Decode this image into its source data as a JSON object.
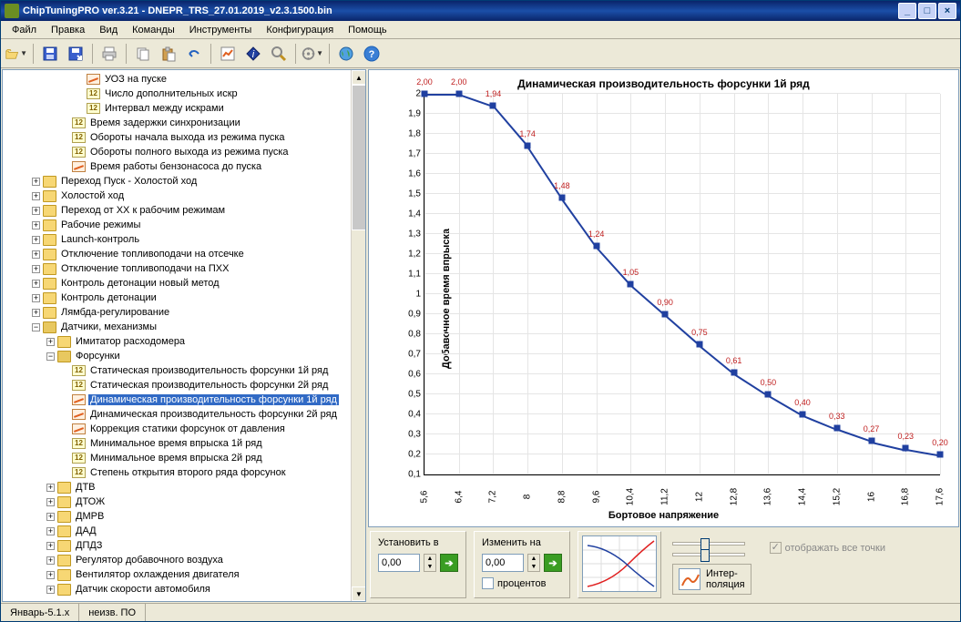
{
  "title": "ChipTuningPRO ver.3.21 - DNEPR_TRS_27.01.2019_v2.3.1500.bin",
  "menu": [
    "Файл",
    "Правка",
    "Вид",
    "Команды",
    "Инструменты",
    "Конфигурация",
    "Помощь"
  ],
  "tree": [
    {
      "d": 5,
      "type": "chart",
      "label": "УОЗ на пуске"
    },
    {
      "d": 5,
      "type": "12",
      "label": "Число дополнительных искр"
    },
    {
      "d": 5,
      "type": "12",
      "label": "Интервал между искрами"
    },
    {
      "d": 4,
      "type": "12",
      "label": "Время задержки синхронизации"
    },
    {
      "d": 4,
      "type": "12",
      "label": "Обороты начала выхода из режима пуска"
    },
    {
      "d": 4,
      "type": "12",
      "label": "Обороты полного выхода из режима пуска"
    },
    {
      "d": 4,
      "type": "chart",
      "label": "Время работы бензонасоса до пуска"
    },
    {
      "d": 2,
      "type": "folder",
      "exp": "+",
      "label": "Переход Пуск - Холостой ход"
    },
    {
      "d": 2,
      "type": "folder",
      "exp": "+",
      "label": "Холостой ход"
    },
    {
      "d": 2,
      "type": "folder",
      "exp": "+",
      "label": "Переход от ХХ к рабочим режимам"
    },
    {
      "d": 2,
      "type": "folder",
      "exp": "+",
      "label": "Рабочие режимы"
    },
    {
      "d": 2,
      "type": "folder",
      "exp": "+",
      "label": "Launch-контроль"
    },
    {
      "d": 2,
      "type": "folder",
      "exp": "+",
      "label": "Отключение топливоподачи на отсечке"
    },
    {
      "d": 2,
      "type": "folder",
      "exp": "+",
      "label": "Отключение топливоподачи на ПХХ"
    },
    {
      "d": 2,
      "type": "folder",
      "exp": "+",
      "label": "Контроль детонации новый метод"
    },
    {
      "d": 2,
      "type": "folder",
      "exp": "+",
      "label": "Контроль детонации"
    },
    {
      "d": 2,
      "type": "folder",
      "exp": "+",
      "label": "Лямбда-регулирование"
    },
    {
      "d": 2,
      "type": "folder-open",
      "exp": "−",
      "label": "Датчики, механизмы"
    },
    {
      "d": 3,
      "type": "folder",
      "exp": "+",
      "label": "Имитатор расходомера"
    },
    {
      "d": 3,
      "type": "folder-open",
      "exp": "−",
      "label": "Форсунки"
    },
    {
      "d": 4,
      "type": "12",
      "label": "Статическая производительность форсунки 1й ряд"
    },
    {
      "d": 4,
      "type": "12",
      "label": "Статическая производительность форсунки 2й ряд"
    },
    {
      "d": 4,
      "type": "chart",
      "label": "Динамическая производительность форсунки 1й ряд",
      "selected": true
    },
    {
      "d": 4,
      "type": "chart",
      "label": "Динамическая производительность форсунки 2й ряд"
    },
    {
      "d": 4,
      "type": "chart",
      "label": "Коррекция статики форсунок от давления"
    },
    {
      "d": 4,
      "type": "12",
      "label": "Минимальное время впрыска 1й ряд"
    },
    {
      "d": 4,
      "type": "12",
      "label": "Минимальное время впрыска 2й ряд"
    },
    {
      "d": 4,
      "type": "12",
      "label": "Степень открытия второго ряда форсунок"
    },
    {
      "d": 3,
      "type": "folder",
      "exp": "+",
      "label": "ДТВ"
    },
    {
      "d": 3,
      "type": "folder",
      "exp": "+",
      "label": "ДТОЖ"
    },
    {
      "d": 3,
      "type": "folder",
      "exp": "+",
      "label": "ДМРВ"
    },
    {
      "d": 3,
      "type": "folder",
      "exp": "+",
      "label": "ДАД"
    },
    {
      "d": 3,
      "type": "folder",
      "exp": "+",
      "label": "ДПДЗ"
    },
    {
      "d": 3,
      "type": "folder",
      "exp": "+",
      "label": "Регулятор добавочного воздуха"
    },
    {
      "d": 3,
      "type": "folder",
      "exp": "+",
      "label": "Вентилятор охлаждения двигателя"
    },
    {
      "d": 3,
      "type": "folder",
      "exp": "+",
      "label": "Датчик скорости автомобиля"
    }
  ],
  "chart_data": {
    "type": "line",
    "title": "Динамическая производительность форсунки 1й ряд",
    "xlabel": "Бортовое напряжение",
    "ylabel": "Добавочное время впрыска",
    "x": [
      5.6,
      6.4,
      7.2,
      8,
      8.8,
      9.6,
      10.4,
      11.2,
      12,
      12.8,
      13.6,
      14.4,
      15.2,
      16,
      16.8,
      17.6
    ],
    "values": [
      2.0,
      2.0,
      1.94,
      1.74,
      1.48,
      1.24,
      1.05,
      0.9,
      0.75,
      0.61,
      0.5,
      0.4,
      0.33,
      0.27,
      0.23,
      0.2
    ],
    "labels": [
      "2,00",
      "2,00",
      "1,94",
      "1,74",
      "1,48",
      "1,24",
      "1,05",
      "0,90",
      "0,75",
      "0,61",
      "0,50",
      "0,40",
      "0,33",
      "0,27",
      "0,23",
      "0,20"
    ],
    "xticks": [
      "5,6",
      "6,4",
      "7,2",
      "8",
      "8,8",
      "9,6",
      "10,4",
      "11,2",
      "12",
      "12,8",
      "13,6",
      "14,4",
      "15,2",
      "16",
      "16,8",
      "17,6"
    ],
    "yticks": [
      "0,1",
      "0,2",
      "0,3",
      "0,4",
      "0,5",
      "0,6",
      "0,7",
      "0,8",
      "0,9",
      "1",
      "1,1",
      "1,2",
      "1,3",
      "1,4",
      "1,5",
      "1,6",
      "1,7",
      "1,8",
      "1,9",
      "2"
    ],
    "ylim": [
      0.1,
      2.0
    ],
    "xlim": [
      5.6,
      17.6
    ]
  },
  "controls": {
    "set_to": "Установить в",
    "set_val": "0,00",
    "change_by": "Изменить на",
    "change_val": "0,00",
    "percent": "процентов",
    "interp": "Интер-\nполяция",
    "show_all": "отображать все точки"
  },
  "status": [
    "Январь-5.1.x",
    "неизв. ПО"
  ]
}
